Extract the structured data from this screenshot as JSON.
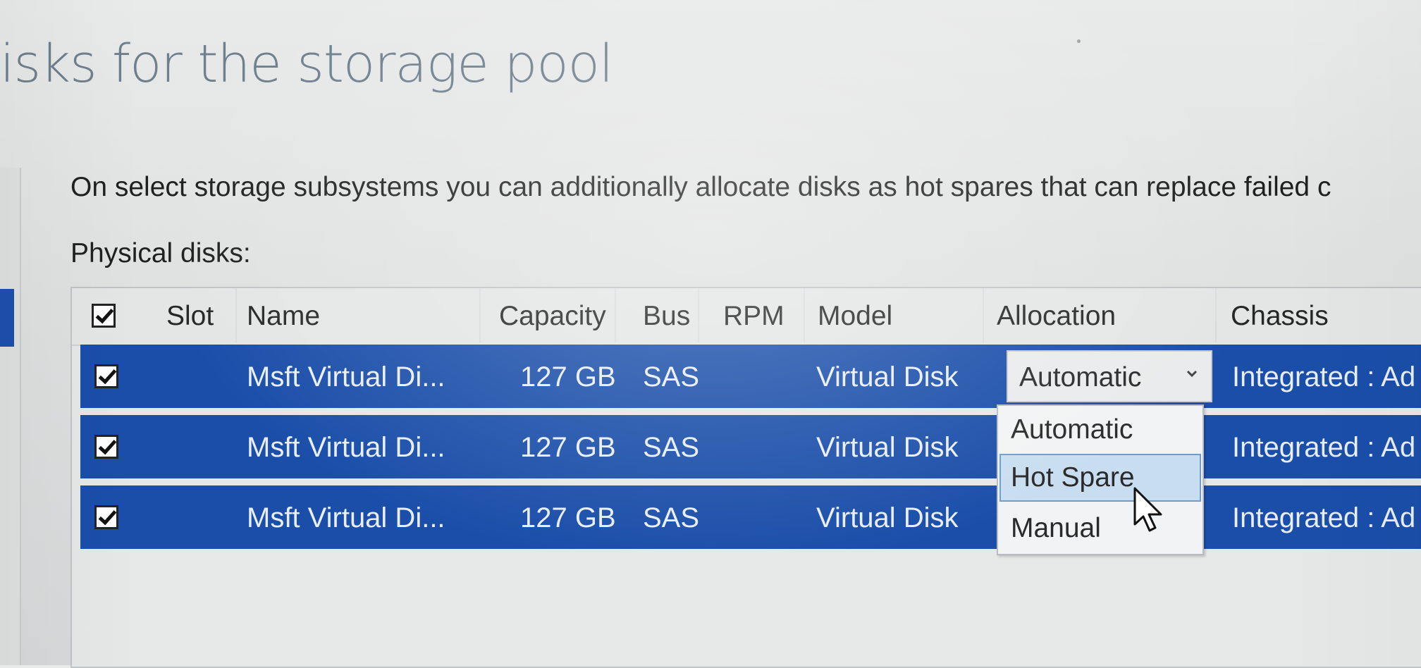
{
  "page": {
    "title": "isks for the storage pool",
    "description": "On select storage subsystems you can additionally allocate disks as hot spares that can replace failed c",
    "section_label": "Physical disks:"
  },
  "table": {
    "header_checked": true,
    "columns": {
      "slot": "Slot",
      "name": "Name",
      "capacity": "Capacity",
      "bus": "Bus",
      "rpm": "RPM",
      "model": "Model",
      "allocation": "Allocation",
      "chassis": "Chassis"
    },
    "rows": [
      {
        "checked": true,
        "slot": "",
        "name": "Msft Virtual Di...",
        "capacity": "127 GB",
        "bus": "SAS",
        "rpm": "",
        "model": "Virtual Disk",
        "allocation": "Automatic",
        "chassis": "Integrated : Ad"
      },
      {
        "checked": true,
        "slot": "",
        "name": "Msft Virtual Di...",
        "capacity": "127 GB",
        "bus": "SAS",
        "rpm": "",
        "model": "Virtual Disk",
        "allocation": "",
        "chassis": "Integrated : Ad"
      },
      {
        "checked": true,
        "slot": "",
        "name": "Msft Virtual Di...",
        "capacity": "127 GB",
        "bus": "SAS",
        "rpm": "",
        "model": "Virtual Disk",
        "allocation": "",
        "chassis": "Integrated : Ad"
      }
    ]
  },
  "allocation_dropdown": {
    "selected": "Automatic",
    "options": [
      "Automatic",
      "Hot Spare",
      "Manual"
    ],
    "hovered_option": "Hot Spare"
  },
  "icons": {
    "checkbox": "checkmark-checkbox-icon",
    "dropdown_arrow": "chevron-down-icon",
    "cursor": "mouse-pointer-icon"
  },
  "colors": {
    "selected_row": "#1a4ea9",
    "title_text": "#6e7f8d",
    "dropdown_hover": "#c8def0"
  }
}
